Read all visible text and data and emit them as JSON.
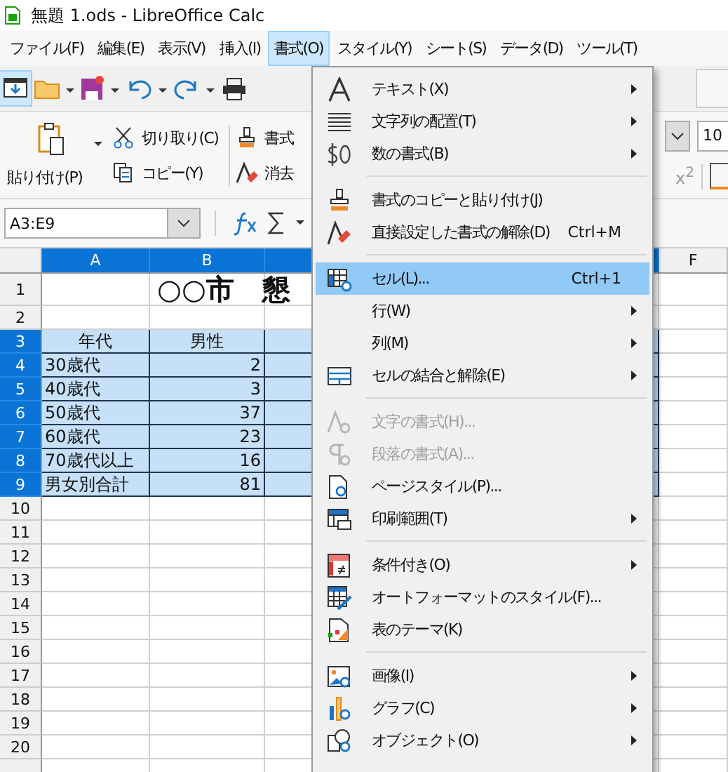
{
  "window": {
    "title": "無題 1.ods - LibreOffice Calc"
  },
  "menu_bar": [
    {
      "label": "ファイル(F)",
      "selected": false
    },
    {
      "label": "編集(E)",
      "selected": false
    },
    {
      "label": "表示(V)",
      "selected": false
    },
    {
      "label": "挿入(I)",
      "selected": false
    },
    {
      "label": "書式(O)",
      "selected": true
    },
    {
      "label": "スタイル(Y)",
      "selected": false
    },
    {
      "label": "シート(S)",
      "selected": false
    },
    {
      "label": "データ(D)",
      "selected": false
    },
    {
      "label": "ツール(T)",
      "selected": false
    }
  ],
  "ribbon": {
    "paste": "貼り付け(P)",
    "cut": "切り取り(C)",
    "copy": "コピー(Y)",
    "format": "書式",
    "clear": "消去",
    "font_size": "10",
    "superscript": "x$^{2}$"
  },
  "formula_bar": {
    "name_box": "A3:E9"
  },
  "sheet": {
    "columns": [
      {
        "label": "A",
        "selected": true
      },
      {
        "label": "B",
        "selected": true
      },
      {
        "selected": true
      },
      {
        "label": "F",
        "selected": false
      }
    ],
    "title": "○○市　懇",
    "rows": [
      {
        "number": "1",
        "selected": false,
        "kind": "title"
      },
      {
        "number": "2",
        "selected": false,
        "kind": "data"
      },
      {
        "number": "3",
        "selected": true,
        "kind": "header",
        "cells": [
          "年代",
          "男性"
        ]
      },
      {
        "number": "4",
        "selected": true,
        "kind": "data",
        "cells": [
          "30歳代",
          "2"
        ]
      },
      {
        "number": "5",
        "selected": true,
        "kind": "data",
        "cells": [
          "40歳代",
          "3"
        ]
      },
      {
        "number": "6",
        "selected": true,
        "kind": "data",
        "cells": [
          "50歳代",
          "37"
        ]
      },
      {
        "number": "7",
        "selected": true,
        "kind": "data",
        "cells": [
          "60歳代",
          "23"
        ]
      },
      {
        "number": "8",
        "selected": true,
        "kind": "data",
        "cells": [
          "70歳代以上",
          "16"
        ]
      },
      {
        "number": "9",
        "selected": true,
        "kind": "data",
        "cells": [
          "男女別合計",
          "81"
        ]
      },
      {
        "number": "10",
        "selected": false,
        "kind": "data"
      },
      {
        "number": "11",
        "selected": false,
        "kind": "data"
      },
      {
        "number": "12",
        "selected": false,
        "kind": "data"
      },
      {
        "number": "13",
        "selected": false,
        "kind": "data"
      },
      {
        "number": "14",
        "selected": false,
        "kind": "data"
      },
      {
        "number": "15",
        "selected": false,
        "kind": "data"
      },
      {
        "number": "16",
        "selected": false,
        "kind": "data"
      },
      {
        "number": "17",
        "selected": false,
        "kind": "data"
      },
      {
        "number": "18",
        "selected": false,
        "kind": "data"
      },
      {
        "number": "19",
        "selected": false,
        "kind": "data"
      },
      {
        "number": "20",
        "selected": false,
        "kind": "data"
      },
      {
        "selected": false,
        "kind": "data"
      }
    ]
  },
  "format_menu": {
    "items": [
      {
        "kind": "item",
        "label": "テキスト(X)",
        "submenu": true,
        "disabled": false,
        "selected": false
      },
      {
        "kind": "item",
        "label": "文字列の配置(T)",
        "submenu": true,
        "disabled": false,
        "selected": false
      },
      {
        "kind": "item",
        "label": "数の書式(B)",
        "submenu": true,
        "disabled": false,
        "selected": false
      },
      {
        "kind": "separator"
      },
      {
        "kind": "item",
        "label": "書式のコピーと貼り付け(J)",
        "submenu": false,
        "disabled": false,
        "selected": false
      },
      {
        "kind": "item",
        "label": "直接設定した書式の解除(D)",
        "shortcut": "Ctrl+M",
        "submenu": false,
        "disabled": false,
        "selected": false
      },
      {
        "kind": "separator"
      },
      {
        "kind": "item",
        "label": "セル(L)...",
        "shortcut": "Ctrl+1",
        "submenu": false,
        "disabled": false,
        "selected": true
      },
      {
        "kind": "item",
        "label": "行(W)",
        "submenu": true,
        "disabled": false,
        "selected": false
      },
      {
        "kind": "item",
        "label": "列(M)",
        "submenu": true,
        "disabled": false,
        "selected": false
      },
      {
        "kind": "item",
        "label": "セルの結合と解除(E)",
        "submenu": true,
        "disabled": false,
        "selected": false
      },
      {
        "kind": "separator"
      },
      {
        "kind": "item",
        "label": "文字の書式(H)...",
        "submenu": false,
        "disabled": true,
        "selected": false
      },
      {
        "kind": "item",
        "label": "段落の書式(A)...",
        "submenu": false,
        "disabled": true,
        "selected": false
      },
      {
        "kind": "item",
        "label": "ページスタイル(P)...",
        "submenu": false,
        "disabled": false,
        "selected": false
      },
      {
        "kind": "item",
        "label": "印刷範囲(T)",
        "submenu": true,
        "disabled": false,
        "selected": false
      },
      {
        "kind": "separator"
      },
      {
        "kind": "item",
        "label": "条件付き(O)",
        "submenu": true,
        "disabled": false,
        "selected": false
      },
      {
        "kind": "item",
        "label": "オートフォーマットのスタイル(F)...",
        "submenu": false,
        "disabled": false,
        "selected": false
      },
      {
        "kind": "item",
        "label": "表のテーマ(K)",
        "submenu": false,
        "disabled": false,
        "selected": false
      },
      {
        "kind": "separator"
      },
      {
        "kind": "item",
        "label": "画像(I)",
        "submenu": true,
        "disabled": false,
        "selected": false
      },
      {
        "kind": "item",
        "label": "グラフ(C)",
        "submenu": true,
        "disabled": false,
        "selected": false
      },
      {
        "kind": "item",
        "label": "オブジェクト(O)",
        "submenu": true,
        "disabled": false,
        "selected": false
      }
    ]
  }
}
